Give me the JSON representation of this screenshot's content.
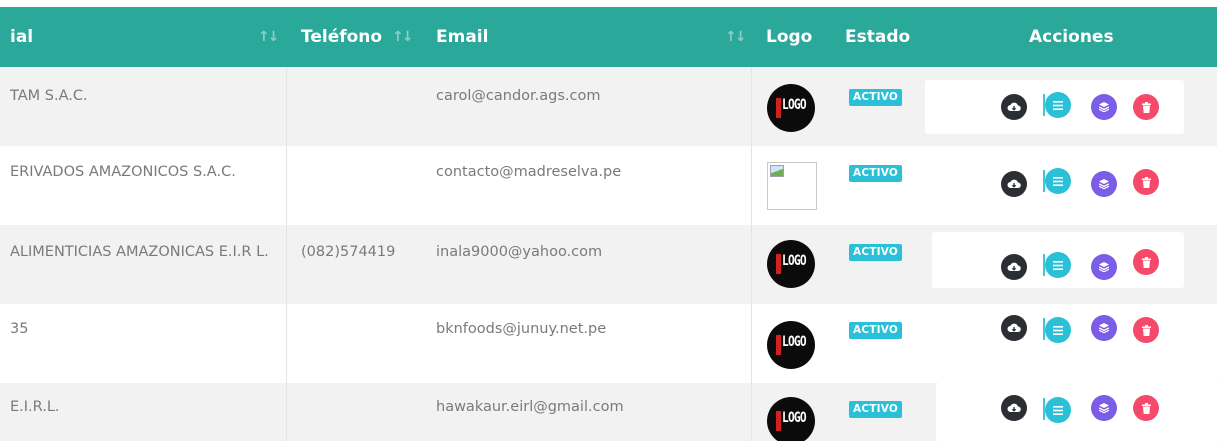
{
  "header": {
    "razon_social_label": "ial",
    "telefono_label": "Teléfono",
    "email_label": "Email",
    "logo_label": "Logo",
    "estado_label": "Estado",
    "acciones_label": "Acciones",
    "sort_glyph": "↑↓"
  },
  "colors": {
    "header_bg": "#2aa89a",
    "badge_bg": "#29c0d8",
    "btn_download": "#2b2f33",
    "btn_list": "#29c0d8",
    "btn_layers": "#7b5de6",
    "btn_delete": "#f54a6a"
  },
  "icons": {
    "download": "cloud-download-icon",
    "list": "list-icon",
    "layers": "layers-icon",
    "delete": "trash-icon"
  },
  "rows": [
    {
      "razon_social": "TAM S.A.C.",
      "telefono": "",
      "email": "carol@candor.ags.com",
      "logo": "logo-image",
      "estado": "ACTIVO"
    },
    {
      "razon_social": "ERIVADOS AMAZONICOS S.A.C.",
      "telefono": "",
      "email": "contacto@madreselva.pe",
      "logo": "broken-image",
      "estado": "ACTIVO"
    },
    {
      "razon_social": "ALIMENTICIAS AMAZONICAS E.I.R L.",
      "telefono": "(082)574419",
      "email": "inala9000@yahoo.com",
      "logo": "logo-image",
      "estado": "ACTIVO"
    },
    {
      "razon_social": "35",
      "telefono": "",
      "email": "bknfoods@junuy.net.pe",
      "logo": "logo-image",
      "estado": "ACTIVO"
    },
    {
      "razon_social": "E.I.R.L.",
      "telefono": "",
      "email": "hawakaur.eirl@gmail.com",
      "logo": "logo-image",
      "estado": "ACTIVO"
    }
  ],
  "logo_text": "LOGO"
}
